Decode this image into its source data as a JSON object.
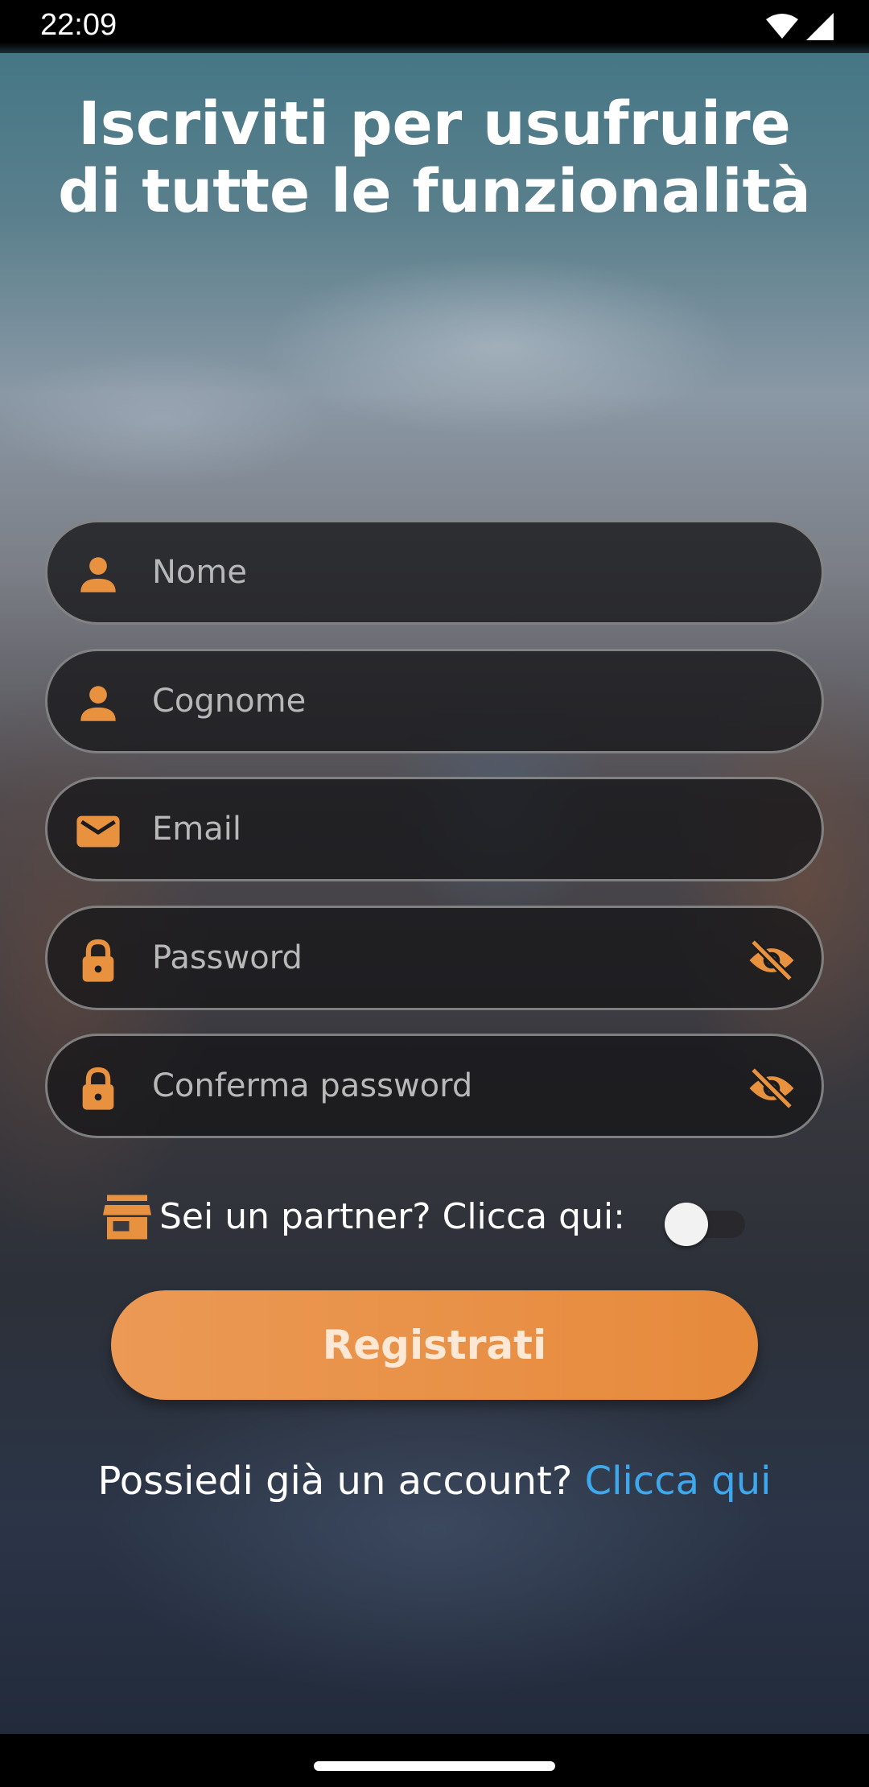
{
  "status_bar": {
    "time": "22:09"
  },
  "title": "Iscriviti per usufruire di tutte le funzionalità",
  "form": {
    "nome_placeholder": "Nome",
    "cognome_placeholder": "Cognome",
    "email_placeholder": "Email",
    "password_placeholder": "Password",
    "confirm_password_placeholder": "Conferma password"
  },
  "partner": {
    "label": "Sei un partner? Clicca qui:",
    "toggle_on": false
  },
  "register_button": "Registrati",
  "login_prompt": {
    "text": "Possiedi già un account?",
    "link": "Clicca qui"
  },
  "colors": {
    "accent": "#E8913F",
    "link": "#3EA8EE",
    "field_bg": "#161618"
  },
  "icons": [
    "person-icon",
    "mail-icon",
    "lock-icon",
    "eye-off-icon",
    "store-icon",
    "wifi-icon",
    "signal-icon"
  ]
}
